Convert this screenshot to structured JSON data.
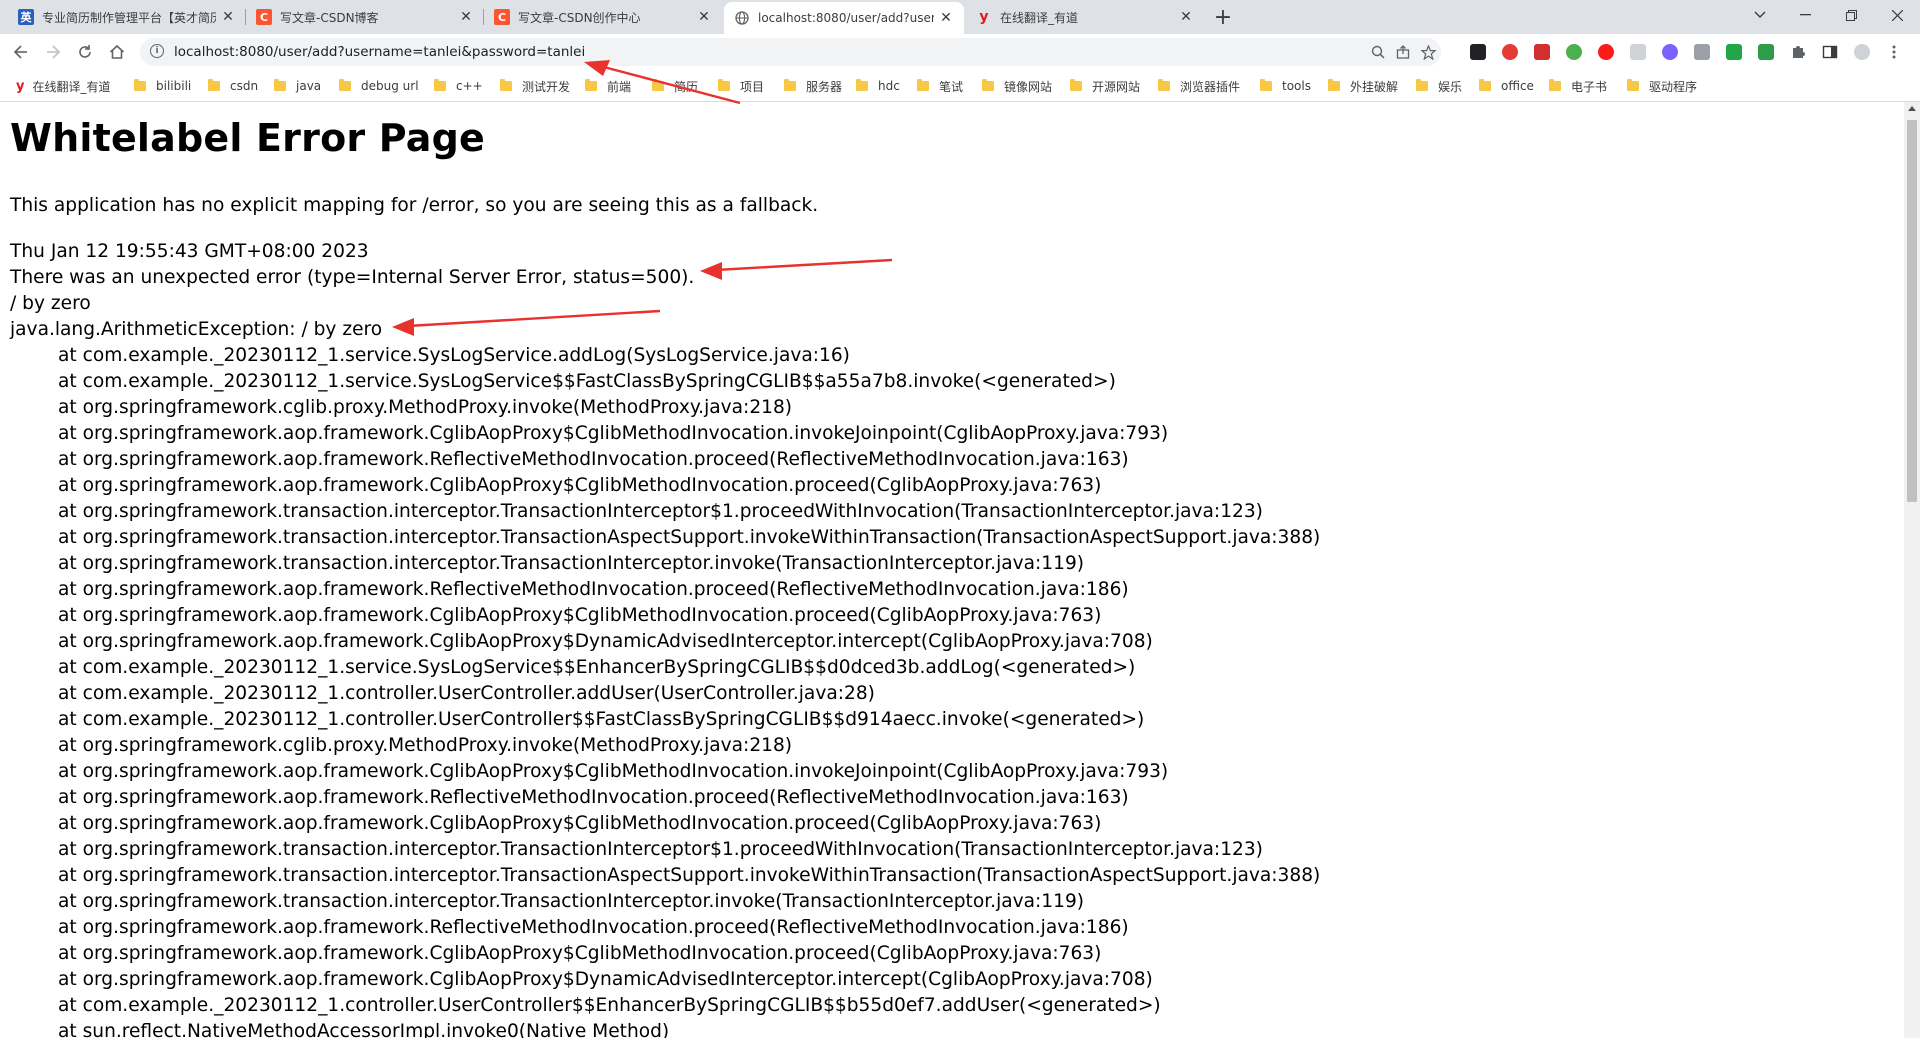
{
  "browser": {
    "tabs": [
      {
        "title": "专业简历制作管理平台【英才简历",
        "favicon_text": "英",
        "favicon_color": "#2b5fbd",
        "active": false
      },
      {
        "title": "写文章-CSDN博客",
        "favicon_text": "C",
        "favicon_color": "#fc5531",
        "active": false
      },
      {
        "title": "写文章-CSDN创作中心",
        "favicon_text": "C",
        "favicon_color": "#fc5531",
        "active": false
      },
      {
        "title": "localhost:8080/user/add?usern",
        "favicon_text": "globe-icon",
        "favicon_color": "#5f6368",
        "active": true
      },
      {
        "title": "在线翻译_有道",
        "favicon_text": "y",
        "favicon_color": "#e3191e",
        "active": false
      }
    ],
    "new_tab_label": "+",
    "url": "localhost:8080/user/add?username=tanlei&password=tanlei"
  },
  "bookmarks": [
    {
      "label": "在线翻译_有道",
      "kind": "youdao"
    },
    {
      "label": "bilibili",
      "kind": "folder"
    },
    {
      "label": "csdn",
      "kind": "folder"
    },
    {
      "label": "java",
      "kind": "folder"
    },
    {
      "label": "debug url",
      "kind": "folder"
    },
    {
      "label": "c++",
      "kind": "folder"
    },
    {
      "label": "测试开发",
      "kind": "folder"
    },
    {
      "label": "前端",
      "kind": "folder"
    },
    {
      "label": "简历",
      "kind": "folder"
    },
    {
      "label": "项目",
      "kind": "folder"
    },
    {
      "label": "服务器",
      "kind": "folder"
    },
    {
      "label": "hdc",
      "kind": "folder"
    },
    {
      "label": "笔试",
      "kind": "folder"
    },
    {
      "label": "镜像网站",
      "kind": "folder"
    },
    {
      "label": "开源网站",
      "kind": "folder"
    },
    {
      "label": "浏览器插件",
      "kind": "folder"
    },
    {
      "label": "tools",
      "kind": "folder"
    },
    {
      "label": "外挂破解",
      "kind": "folder"
    },
    {
      "label": "娱乐",
      "kind": "folder"
    },
    {
      "label": "office",
      "kind": "folder"
    },
    {
      "label": "电子书",
      "kind": "folder"
    },
    {
      "label": "驱动程序",
      "kind": "folder"
    }
  ],
  "page": {
    "title": "Whitelabel Error Page",
    "fallback_message": "This application has no explicit mapping for /error, so you are seeing this as a fallback.",
    "timestamp": "Thu Jan 12 19:55:43 GMT+08:00 2023",
    "error_summary": "There was an unexpected error (type=Internal Server Error, status=500).",
    "message": "/ by zero",
    "exception": "java.lang.ArithmeticException: / by zero",
    "stack_trace": [
      "at com.example._20230112_1.service.SysLogService.addLog(SysLogService.java:16)",
      "at com.example._20230112_1.service.SysLogService$$FastClassBySpringCGLIB$$a55a7b8.invoke(<generated>)",
      "at org.springframework.cglib.proxy.MethodProxy.invoke(MethodProxy.java:218)",
      "at org.springframework.aop.framework.CglibAopProxy$CglibMethodInvocation.invokeJoinpoint(CglibAopProxy.java:793)",
      "at org.springframework.aop.framework.ReflectiveMethodInvocation.proceed(ReflectiveMethodInvocation.java:163)",
      "at org.springframework.aop.framework.CglibAopProxy$CglibMethodInvocation.proceed(CglibAopProxy.java:763)",
      "at org.springframework.transaction.interceptor.TransactionInterceptor$1.proceedWithInvocation(TransactionInterceptor.java:123)",
      "at org.springframework.transaction.interceptor.TransactionAspectSupport.invokeWithinTransaction(TransactionAspectSupport.java:388)",
      "at org.springframework.transaction.interceptor.TransactionInterceptor.invoke(TransactionInterceptor.java:119)",
      "at org.springframework.aop.framework.ReflectiveMethodInvocation.proceed(ReflectiveMethodInvocation.java:186)",
      "at org.springframework.aop.framework.CglibAopProxy$CglibMethodInvocation.proceed(CglibAopProxy.java:763)",
      "at org.springframework.aop.framework.CglibAopProxy$DynamicAdvisedInterceptor.intercept(CglibAopProxy.java:708)",
      "at com.example._20230112_1.service.SysLogService$$EnhancerBySpringCGLIB$$d0dced3b.addLog(<generated>)",
      "at com.example._20230112_1.controller.UserController.addUser(UserController.java:28)",
      "at com.example._20230112_1.controller.UserController$$FastClassBySpringCGLIB$$d914aecc.invoke(<generated>)",
      "at org.springframework.cglib.proxy.MethodProxy.invoke(MethodProxy.java:218)",
      "at org.springframework.aop.framework.CglibAopProxy$CglibMethodInvocation.invokeJoinpoint(CglibAopProxy.java:793)",
      "at org.springframework.aop.framework.ReflectiveMethodInvocation.proceed(ReflectiveMethodInvocation.java:163)",
      "at org.springframework.aop.framework.CglibAopProxy$CglibMethodInvocation.proceed(CglibAopProxy.java:763)",
      "at org.springframework.transaction.interceptor.TransactionInterceptor$1.proceedWithInvocation(TransactionInterceptor.java:123)",
      "at org.springframework.transaction.interceptor.TransactionAspectSupport.invokeWithinTransaction(TransactionAspectSupport.java:388)",
      "at org.springframework.transaction.interceptor.TransactionInterceptor.invoke(TransactionInterceptor.java:119)",
      "at org.springframework.aop.framework.ReflectiveMethodInvocation.proceed(ReflectiveMethodInvocation.java:186)",
      "at org.springframework.aop.framework.CglibAopProxy$CglibMethodInvocation.proceed(CglibAopProxy.java:763)",
      "at org.springframework.aop.framework.CglibAopProxy$DynamicAdvisedInterceptor.intercept(CglibAopProxy.java:708)",
      "at com.example._20230112_1.controller.UserController$$EnhancerBySpringCGLIB$$b55d0ef7.addUser(<generated>)",
      "at sun.reflect.NativeMethodAccessorImpl.invoke0(Native Method)"
    ]
  },
  "colors": {
    "annotation_arrow": "#e8322d",
    "folder": "#f6c846",
    "tabstrip": "#dee1e6"
  }
}
